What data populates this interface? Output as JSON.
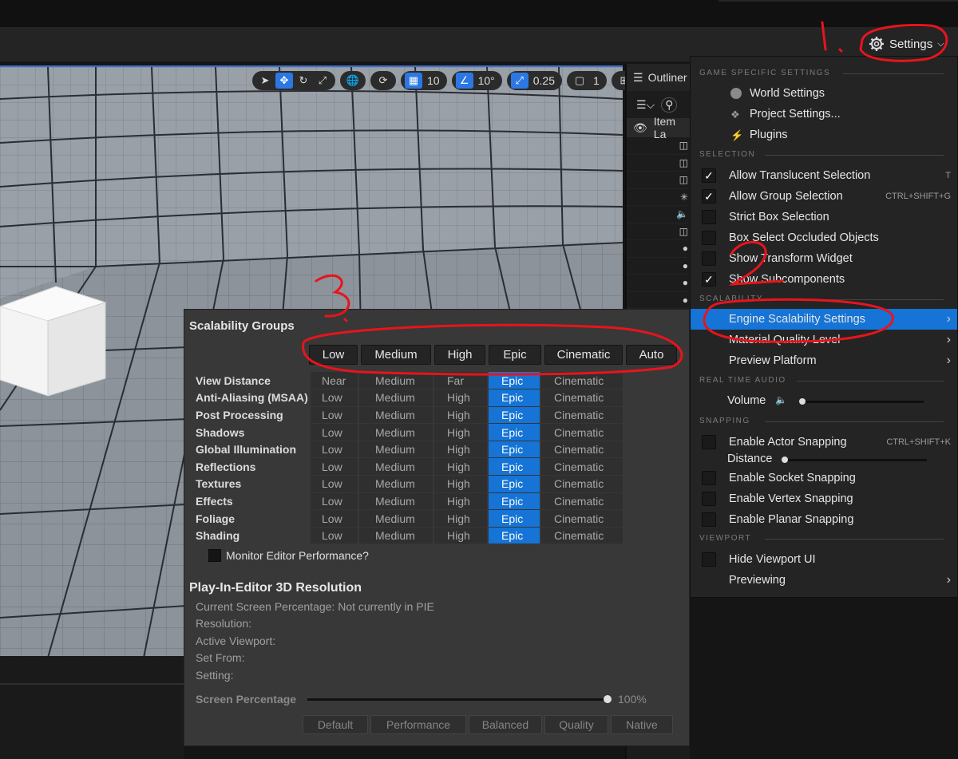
{
  "header": {
    "settings_label": "Settings"
  },
  "viewport_toolbar": {
    "grid_snap": "10",
    "rotation_snap": "10°",
    "scale_snap": "0.25",
    "camera_speed": "1"
  },
  "outliner": {
    "title": "Outliner",
    "column_label": "Item La"
  },
  "scalability": {
    "title": "Scalability Groups",
    "presets": [
      "Low",
      "Medium",
      "High",
      "Epic",
      "Cinematic",
      "Auto"
    ],
    "rows": [
      {
        "label": "View Distance",
        "levels": [
          "Near",
          "Medium",
          "Far",
          "Epic",
          "Cinematic"
        ]
      },
      {
        "label": "Anti-Aliasing (MSAA)",
        "levels": [
          "Low",
          "Medium",
          "High",
          "Epic",
          "Cinematic"
        ]
      },
      {
        "label": "Post Processing",
        "levels": [
          "Low",
          "Medium",
          "High",
          "Epic",
          "Cinematic"
        ]
      },
      {
        "label": "Shadows",
        "levels": [
          "Low",
          "Medium",
          "High",
          "Epic",
          "Cinematic"
        ]
      },
      {
        "label": "Global Illumination",
        "levels": [
          "Low",
          "Medium",
          "High",
          "Epic",
          "Cinematic"
        ]
      },
      {
        "label": "Reflections",
        "levels": [
          "Low",
          "Medium",
          "High",
          "Epic",
          "Cinematic"
        ]
      },
      {
        "label": "Textures",
        "levels": [
          "Low",
          "Medium",
          "High",
          "Epic",
          "Cinematic"
        ]
      },
      {
        "label": "Effects",
        "levels": [
          "Low",
          "Medium",
          "High",
          "Epic",
          "Cinematic"
        ]
      },
      {
        "label": "Foliage",
        "levels": [
          "Low",
          "Medium",
          "High",
          "Epic",
          "Cinematic"
        ]
      },
      {
        "label": "Shading",
        "levels": [
          "Low",
          "Medium",
          "High",
          "Epic",
          "Cinematic"
        ]
      }
    ],
    "selected_level": "Epic",
    "monitor_label": "Monitor Editor Performance?",
    "pie_title": "Play-In-Editor 3D Resolution",
    "pie_lines": [
      "Current Screen Percentage: Not currently in PIE",
      "Resolution:",
      "Active Viewport:",
      "Set From:",
      "Setting:"
    ],
    "screen_percentage_label": "Screen Percentage",
    "screen_percentage_value": "100%",
    "screen_percentage_fraction": 1.0,
    "quality_buttons": [
      "Default",
      "Performance",
      "Balanced",
      "Quality",
      "Native"
    ]
  },
  "menu": {
    "sections": {
      "game": "GAME SPECIFIC SETTINGS",
      "selection": "SELECTION",
      "scalability": "SCALABILITY",
      "audio": "REAL TIME AUDIO",
      "snapping": "SNAPPING",
      "viewport": "VIEWPORT"
    },
    "world_settings": "World Settings",
    "project_settings": "Project Settings...",
    "plugins": "Plugins",
    "allow_translucent": "Allow Translucent Selection",
    "allow_translucent_shortcut": "T",
    "allow_group": "Allow Group Selection",
    "allow_group_shortcut": "CTRL+SHIFT+G",
    "strict_box": "Strict Box Selection",
    "box_occluded": "Box Select Occluded Objects",
    "show_transform": "Show Transform Widget",
    "show_subcomponents": "Show Subcomponents",
    "engine_scalability": "Engine Scalability Settings",
    "material_quality": "Material Quality Level",
    "preview_platform": "Preview Platform",
    "volume": "Volume",
    "volume_level": 0.0,
    "enable_actor_snapping": "Enable Actor Snapping",
    "actor_snapping_shortcut": "CTRL+SHIFT+K",
    "distance": "Distance",
    "distance_level": 0.0,
    "enable_socket": "Enable Socket Snapping",
    "enable_vertex": "Enable Vertex Snapping",
    "enable_planar": "Enable Planar Snapping",
    "hide_viewport_ui": "Hide Viewport UI",
    "previewing": "Previewing"
  },
  "annotations": {
    "one": "1.",
    "two": "2",
    "three": "3."
  },
  "colors": {
    "accent": "#1574d6",
    "annotation": "#e8141c",
    "menu_bg": "#242424",
    "panel_bg": "#383838"
  }
}
